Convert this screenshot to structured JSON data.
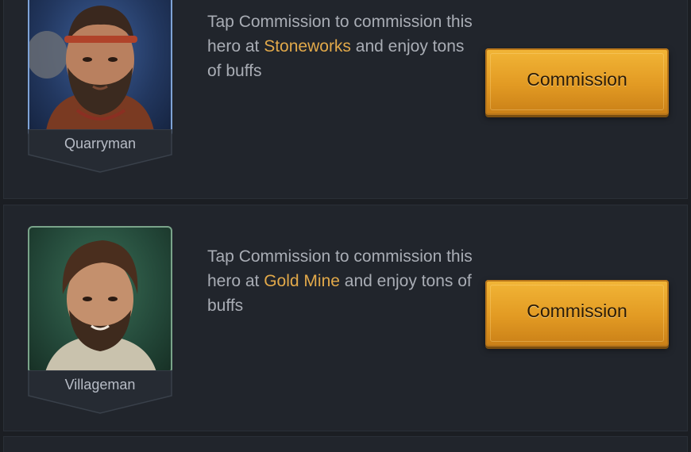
{
  "heroes": [
    {
      "name": "Quarryman",
      "desc_prefix": "Tap Commission to commission this hero at ",
      "building": "Stoneworks",
      "desc_suffix": " and enjoy tons of buffs",
      "button_label": "Commission",
      "frame_color": "#7fa3d6"
    },
    {
      "name": "Villageman",
      "desc_prefix": "Tap Commission to commission this hero at ",
      "building": "Gold Mine",
      "desc_suffix": " and enjoy tons of buffs",
      "button_label": "Commission",
      "frame_color": "#7aa48a"
    }
  ],
  "colors": {
    "background": "#1b1e23",
    "card": "#21252c",
    "highlight": "#e2a94a",
    "button": "#e29a23"
  }
}
